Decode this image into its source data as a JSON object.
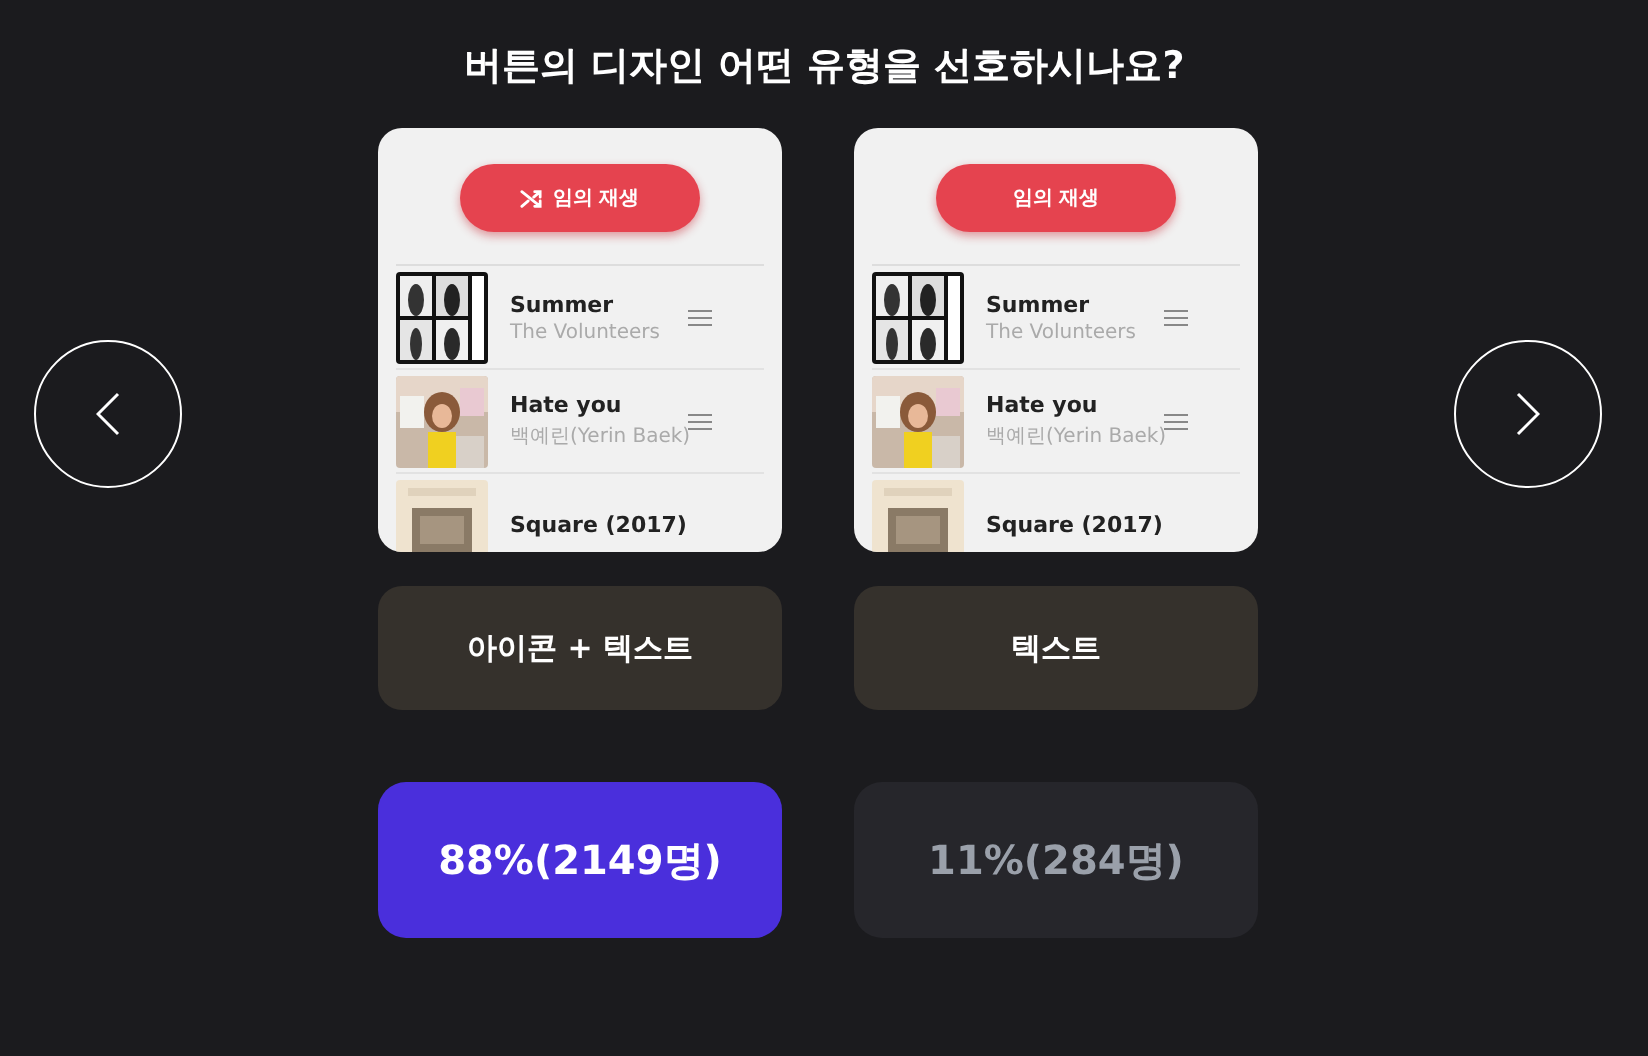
{
  "title": "버튼의 디자인 어떤 유형을 선호하시나요?",
  "options": [
    {
      "preview": {
        "button": {
          "label": "임의 재생",
          "kind": "icon-text"
        },
        "tracks": [
          {
            "title": "Summer",
            "artist": "The Volunteers"
          },
          {
            "title": "Hate you",
            "artist": "백예린(Yerin Baek)"
          },
          {
            "title": "Square (2017)"
          }
        ]
      },
      "label": "아이콘 + 텍스트",
      "result": "88%(2149명)",
      "selected": true
    },
    {
      "preview": {
        "button": {
          "label": "임의 재생",
          "kind": "text"
        },
        "tracks": [
          {
            "title": "Summer",
            "artist": "The Volunteers"
          },
          {
            "title": "Hate you",
            "artist": "백예린(Yerin Baek)"
          },
          {
            "title": "Square (2017)"
          }
        ]
      },
      "label": "텍스트",
      "result": "11%(284명)",
      "selected": false
    }
  ]
}
